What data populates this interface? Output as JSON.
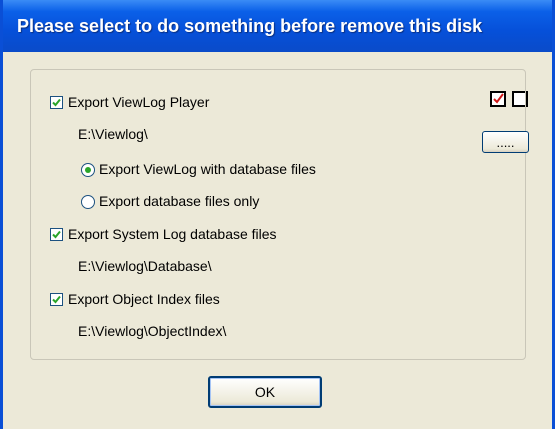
{
  "window": {
    "title": "Please select to do something before remove this disk"
  },
  "toolbar": {
    "select_all_icon": "checked-box-icon",
    "clear_all_icon": "empty-box-icon"
  },
  "options": {
    "export_player": {
      "label": "Export ViewLog Player",
      "checked": true,
      "path": "E:\\Viewlog\\"
    },
    "browse_label": ".....",
    "radio_with_db": {
      "label": "Export ViewLog with database files",
      "selected": true
    },
    "radio_db_only": {
      "label": "Export database files only",
      "selected": false
    },
    "export_syslog": {
      "label": "Export System Log database files",
      "checked": true,
      "path": "E:\\Viewlog\\Database\\"
    },
    "export_object": {
      "label": "Export Object Index files",
      "checked": true,
      "path": "E:\\Viewlog\\ObjectIndex\\"
    }
  },
  "buttons": {
    "ok": "OK"
  },
  "colors": {
    "title_bar": "#0650d9",
    "check_mark": "#2aa52a",
    "dialog_bg": "#ece9d8"
  }
}
